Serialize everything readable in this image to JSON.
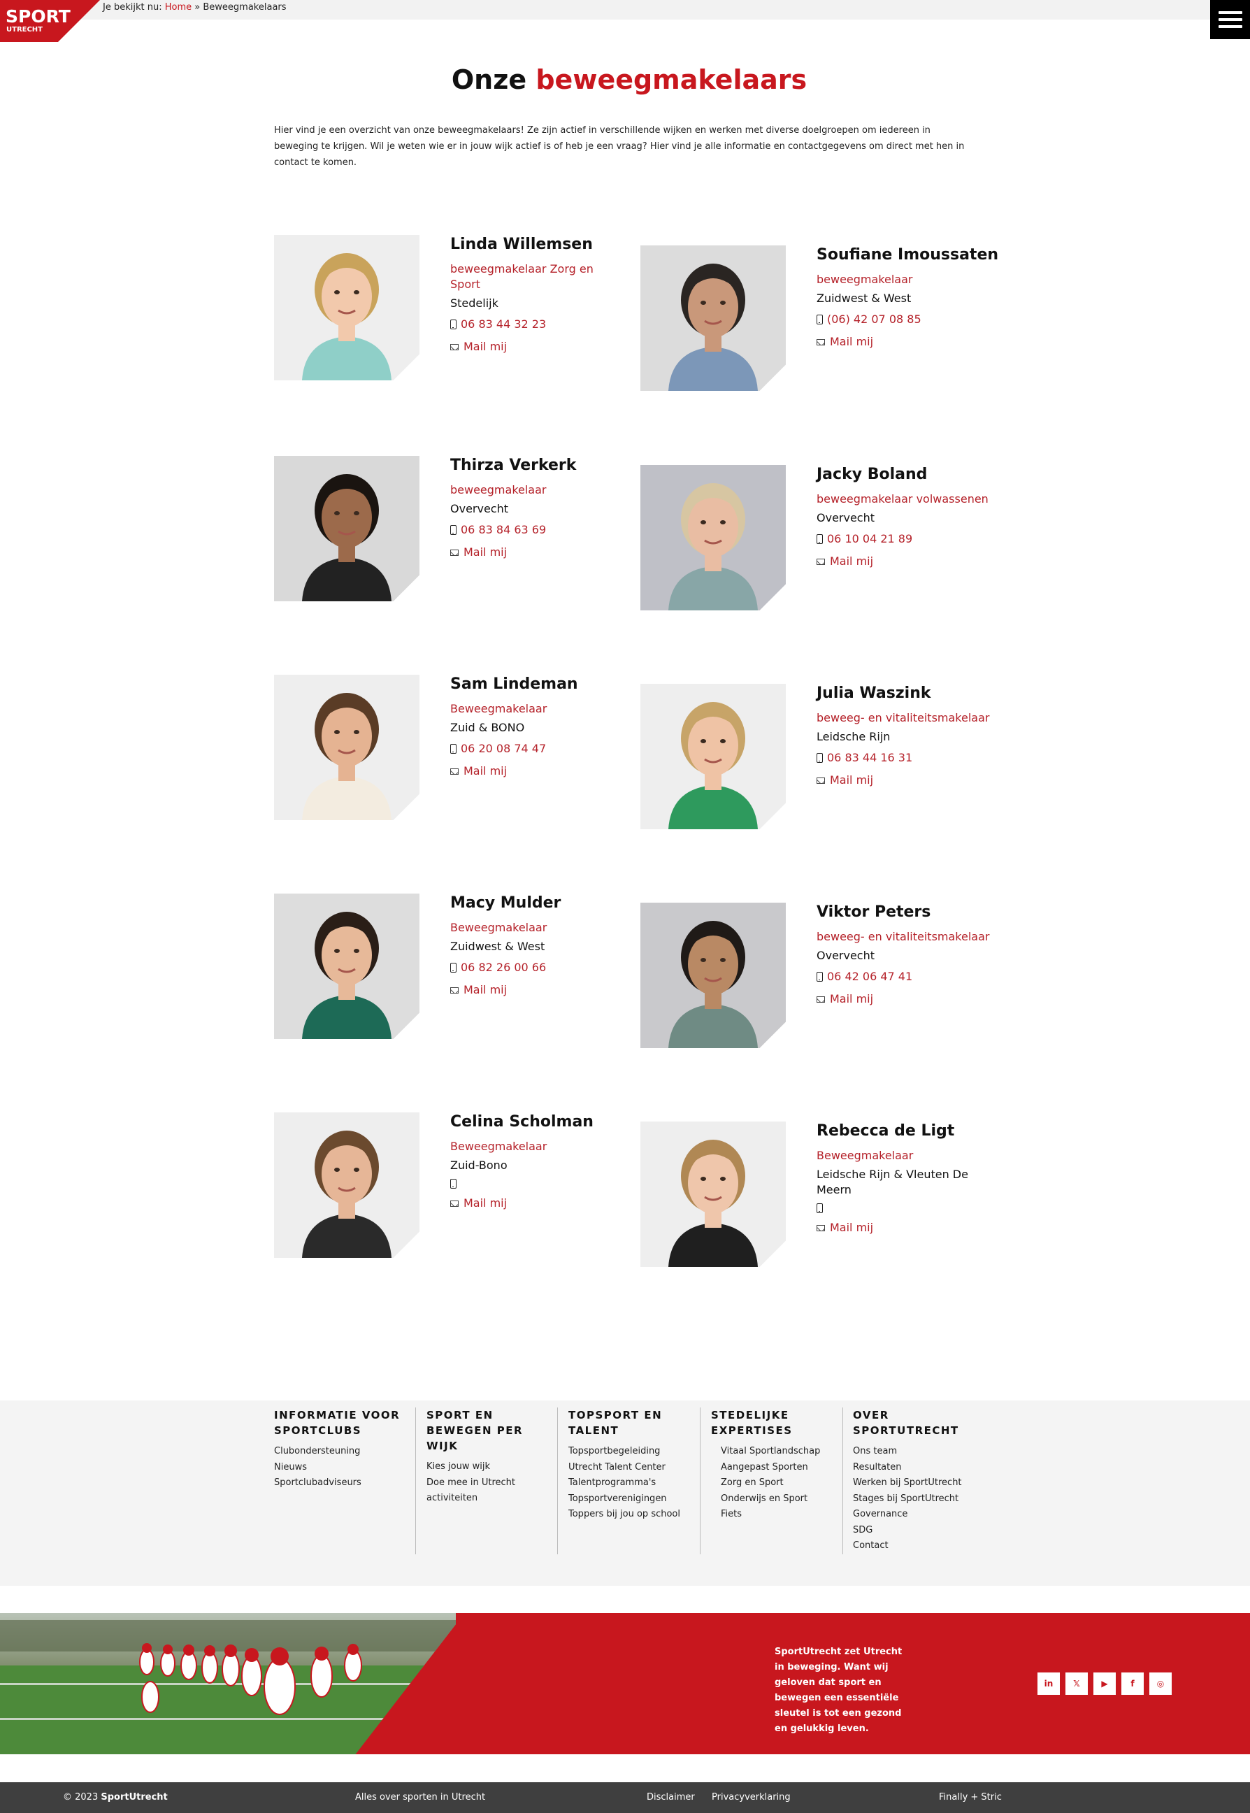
{
  "header": {
    "logo_text_top": "SPORT",
    "logo_text_bottom": "UTRECHT",
    "breadcrumb_prefix": "Je bekijkt nu:",
    "breadcrumb_home": "Home",
    "breadcrumb_separator": "»",
    "breadcrumb_current": "Beweegmakelaars",
    "menu_icon": "hamburger-icon"
  },
  "main": {
    "title_part1": "Onze",
    "title_part2": "beweegmakelaars",
    "intro": "Hier vind je een overzicht van onze beweegmakelaars! Ze zijn actief in verschillende wijken en werken met diverse doelgroepen om iedereen in beweging te krijgen. Wil je weten wie er in jouw wijk actief is of heb je een vraag? Hier vind je alle informatie en contactgegevens om direct met hen in contact te komen."
  },
  "people": [
    {
      "name": "Linda Willemsen",
      "role": "beweegmakelaar Zorg en Sport",
      "area": "Stedelijk",
      "phone": "06 83 44 32 23",
      "mail": "Mail mij"
    },
    {
      "name": "Soufiane Imoussaten",
      "role": "beweegmakelaar",
      "area": "Zuidwest & West",
      "phone": "(06) 42 07 08 85",
      "mail": "Mail mij"
    },
    {
      "name": "Thirza Verkerk",
      "role": "beweegmakelaar",
      "area": "Overvecht",
      "phone": "06 83 84 63 69",
      "mail": "Mail mij"
    },
    {
      "name": "Jacky Boland",
      "role": "beweegmakelaar volwassenen",
      "area": "Overvecht",
      "phone": "06 10 04 21 89",
      "mail": "Mail mij"
    },
    {
      "name": "Sam Lindeman",
      "role": "Beweegmakelaar",
      "area": "Zuid & BONO",
      "phone": "06 20 08 74 47",
      "mail": "Mail mij"
    },
    {
      "name": "Julia Waszink",
      "role": "beweeg- en vitaliteitsmakelaar",
      "area": "Leidsche Rijn",
      "phone": "06 83 44 16 31",
      "mail": "Mail mij"
    },
    {
      "name": "Macy Mulder",
      "role": "Beweegmakelaar",
      "area": "Zuidwest & West",
      "phone": "06 82 26 00 66",
      "mail": "Mail mij"
    },
    {
      "name": "Viktor Peters",
      "role": "beweeg- en vitaliteitsmakelaar",
      "area": "Overvecht",
      "phone": "06 42 06 47 41",
      "mail": "Mail mij"
    },
    {
      "name": "Celina Scholman",
      "role": "Beweegmakelaar",
      "area": "Zuid-Bono",
      "phone": "",
      "mail": "Mail mij"
    },
    {
      "name": "Rebecca de Ligt",
      "role": "Beweegmakelaar",
      "area": "Leidsche Rijn & Vleuten De Meern",
      "phone": "",
      "mail": "Mail mij"
    }
  ],
  "footer": {
    "columns": [
      {
        "heading": "Informatie voor sportclubs",
        "links": [
          "Clubondersteuning",
          "Nieuws",
          "Sportclubadviseurs"
        ]
      },
      {
        "heading": "Sport en bewegen per wijk",
        "links": [
          "Kies jouw wijk",
          "Doe mee in Utrecht",
          "activiteiten"
        ]
      },
      {
        "heading": "Topsport en talent",
        "links": [
          "Topsportbegeleiding",
          "Utrecht Talent Center",
          "Talentprogramma's",
          "Topsportverenigingen",
          "Toppers bij jou op school"
        ]
      },
      {
        "heading": "Stedelijke expertises",
        "links": [
          "Vitaal Sportlandschap",
          "Aangepast Sporten",
          "Zorg en Sport",
          "Onderwijs en Sport",
          "Fiets"
        ]
      },
      {
        "heading": "Over SportUtrecht",
        "links": [
          "Ons team",
          "Resultaten",
          "Werken bij SportUtrecht",
          "Stages bij SportUtrecht",
          "Governance",
          "SDG",
          "Contact"
        ]
      }
    ]
  },
  "banner": {
    "text": "SportUtrecht zet Utrecht in beweging. Want wij geloven dat sport en bewegen een essentiële sleutel is tot een gezond en gelukkig leven.",
    "socials": [
      {
        "icon": "linkedin-icon",
        "glyph": "in"
      },
      {
        "icon": "x-icon",
        "glyph": "𝕏"
      },
      {
        "icon": "youtube-icon",
        "glyph": "▶"
      },
      {
        "icon": "facebook-icon",
        "glyph": "f"
      },
      {
        "icon": "instagram-icon",
        "glyph": "◎"
      }
    ]
  },
  "bottom": {
    "copyright_prefix": "© 2023",
    "copyright_brand": "SportUtrecht",
    "tagline": "Alles over sporten in Utrecht",
    "disclaimer": "Disclaimer",
    "privacy": "Privacyverklaring",
    "credit": "Finally + Stric"
  },
  "colors": {
    "accent": "#c8171e",
    "footer_bg": "#f4f4f4",
    "bottom_bar": "#3f3f3f"
  }
}
